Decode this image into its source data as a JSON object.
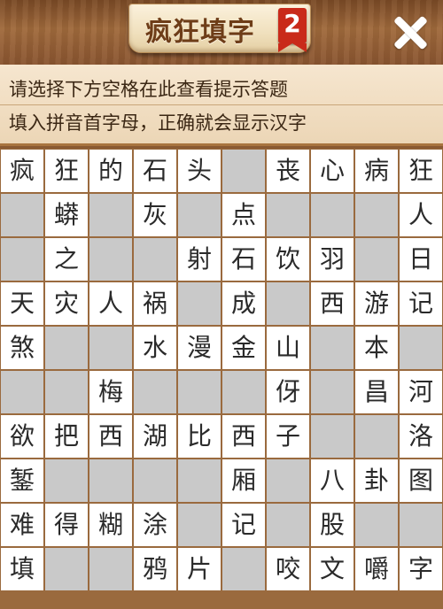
{
  "header": {
    "title": "疯狂填字",
    "badge": "2",
    "close_icon": "close-icon"
  },
  "hints": {
    "line1": "请选择下方空格在此查看提示答题",
    "line2": "填入拼音首字母，正确就会显示汉字"
  },
  "colors": {
    "filled_cell": "#ffffff",
    "empty_cell": "#c9c9c9",
    "grid_line": "#9a6a3e",
    "badge": "#c92a1a"
  },
  "board": {
    "rows": [
      [
        "疯",
        "狂",
        "的",
        "石",
        "头",
        "",
        "丧",
        "心",
        "病",
        "狂"
      ],
      [
        "",
        "蟒",
        "",
        "灰",
        "",
        "点",
        "",
        "",
        "",
        "人"
      ],
      [
        "",
        "之",
        "",
        "",
        "射",
        "石",
        "饮",
        "羽",
        "",
        "日"
      ],
      [
        "天",
        "灾",
        "人",
        "祸",
        "",
        "成",
        "",
        "西",
        "游",
        "记"
      ],
      [
        "煞",
        "",
        "",
        "水",
        "漫",
        "金",
        "山",
        "",
        "本",
        ""
      ],
      [
        "",
        "",
        "梅",
        "",
        "",
        "",
        "伢",
        "",
        "昌",
        "河"
      ],
      [
        "欲",
        "把",
        "西",
        "湖",
        "比",
        "西",
        "子",
        "",
        "",
        "洛"
      ],
      [
        "錾",
        "",
        "",
        "",
        "",
        "厢",
        "",
        "八",
        "卦",
        "图"
      ],
      [
        "难",
        "得",
        "糊",
        "涂",
        "",
        "记",
        "",
        "股",
        "",
        ""
      ],
      [
        "填",
        "",
        "",
        "鸦",
        "片",
        "",
        "咬",
        "文",
        "嚼",
        "字"
      ]
    ],
    "filled": [
      [
        1,
        1,
        1,
        1,
        1,
        0,
        1,
        1,
        1,
        1
      ],
      [
        0,
        1,
        0,
        1,
        0,
        1,
        0,
        0,
        0,
        1
      ],
      [
        0,
        1,
        0,
        0,
        1,
        1,
        1,
        1,
        0,
        1
      ],
      [
        1,
        1,
        1,
        1,
        0,
        1,
        0,
        1,
        1,
        1
      ],
      [
        1,
        0,
        0,
        1,
        1,
        1,
        1,
        0,
        1,
        0
      ],
      [
        0,
        0,
        1,
        0,
        0,
        0,
        1,
        0,
        1,
        1
      ],
      [
        1,
        1,
        1,
        1,
        1,
        1,
        1,
        0,
        0,
        1
      ],
      [
        1,
        0,
        0,
        0,
        0,
        1,
        0,
        1,
        1,
        1
      ],
      [
        1,
        1,
        1,
        1,
        0,
        1,
        0,
        1,
        0,
        0
      ],
      [
        1,
        0,
        0,
        1,
        1,
        0,
        1,
        1,
        1,
        1
      ]
    ]
  }
}
